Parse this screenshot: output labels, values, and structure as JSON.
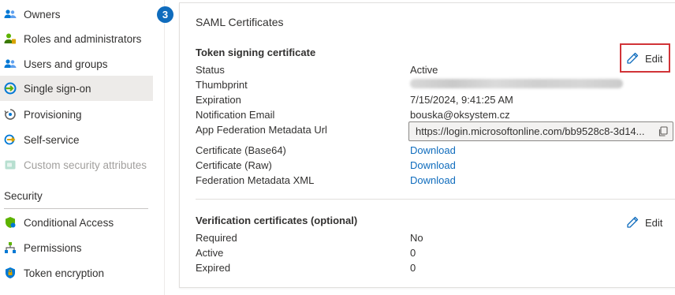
{
  "sidebar": {
    "items": [
      {
        "label": "Owners",
        "icon": "owners-icon"
      },
      {
        "label": "Roles and administrators",
        "icon": "roles-icon"
      },
      {
        "label": "Users and groups",
        "icon": "users-groups-icon"
      },
      {
        "label": "Single sign-on",
        "icon": "single-sign-on-icon",
        "selected": true
      },
      {
        "label": "Provisioning",
        "icon": "provisioning-icon"
      },
      {
        "label": "Self-service",
        "icon": "self-service-icon"
      },
      {
        "label": "Custom security attributes",
        "icon": "custom-attributes-icon",
        "disabled": true
      }
    ],
    "security_section": {
      "title": "Security",
      "items": [
        {
          "label": "Conditional Access",
          "icon": "conditional-access-icon"
        },
        {
          "label": "Permissions",
          "icon": "permissions-icon"
        },
        {
          "label": "Token encryption",
          "icon": "token-encryption-icon"
        }
      ]
    }
  },
  "step_badge": "3",
  "card": {
    "title": "SAML Certificates",
    "token_signing": {
      "heading": "Token signing certificate",
      "edit_label": "Edit",
      "rows": {
        "status_label": "Status",
        "status_value": "Active",
        "thumbprint_label": "Thumbprint",
        "expiration_label": "Expiration",
        "expiration_value": "7/15/2024, 9:41:25 AM",
        "email_label": "Notification Email",
        "email_value": "bouska@oksystem.cz",
        "metadata_url_label": "App Federation Metadata Url",
        "metadata_url_value": "https://login.microsoftonline.com/bb9528c8-3d14...",
        "cert_base64_label": "Certificate (Base64)",
        "cert_raw_label": "Certificate (Raw)",
        "metadata_xml_label": "Federation Metadata XML",
        "download_label": "Download"
      }
    },
    "verification": {
      "heading": "Verification certificates (optional)",
      "edit_label": "Edit",
      "required_label": "Required",
      "required_value": "No",
      "active_label": "Active",
      "active_value": "0",
      "expired_label": "Expired",
      "expired_value": "0"
    }
  },
  "colors": {
    "accent": "#0f6cbd",
    "highlight": "#d13438",
    "selected_bg": "#edebe9"
  }
}
